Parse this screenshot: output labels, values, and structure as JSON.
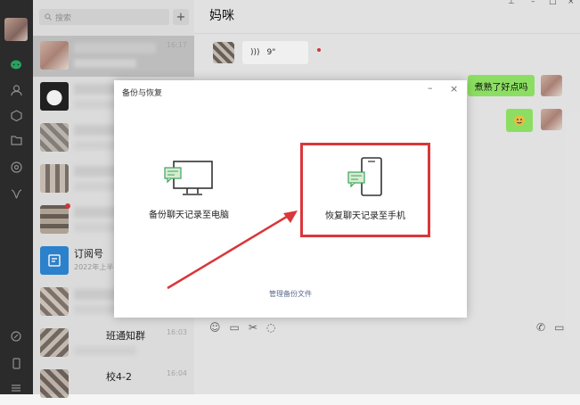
{
  "rail": {
    "icons": [
      "chat-icon",
      "contacts-icon",
      "favorites-icon",
      "folder-icon",
      "moments-icon",
      "miniprogram-icon",
      "link-icon",
      "phone-icon",
      "menu-icon"
    ]
  },
  "list": {
    "search_placeholder": "搜索",
    "plus": "+",
    "rows": [
      {
        "time": "16:17"
      },
      {
        "time": ""
      },
      {
        "time": ""
      },
      {
        "time": ""
      },
      {
        "time": ""
      },
      {
        "time": ""
      },
      {
        "title": "订阅号",
        "sub": "2022年上半"
      },
      {
        "time": ""
      },
      {
        "title_partial": "班通知群",
        "time": "16:03"
      },
      {
        "title_partial": "校4-2",
        "time": "16:04"
      }
    ]
  },
  "chat": {
    "name": "妈咪",
    "voice_duration": "9\"",
    "sent_text": "煮熟了好点吗",
    "minimize": "–",
    "maximize": "□",
    "close": "×"
  },
  "dialog": {
    "title": "备份与恢复",
    "min": "–",
    "close": "×",
    "option_backup": "备份聊天记录至电脑",
    "option_restore": "恢复聊天记录至手机",
    "manage": "管理备份文件"
  },
  "colors": {
    "accent_green": "#2aae67",
    "highlight_red": "#d9373a",
    "bubble_green": "#95ec69"
  }
}
